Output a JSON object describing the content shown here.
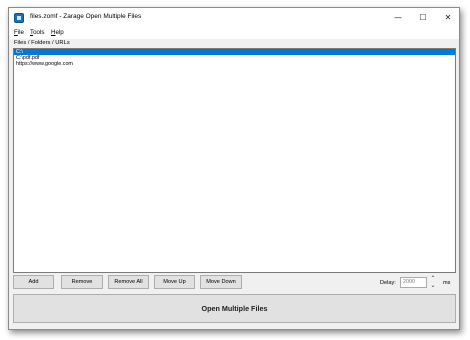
{
  "window": {
    "title": "files.zomf - Zarage Open Multiple Files",
    "controls": {
      "minimize": "—",
      "maximize": "☐",
      "close": "✕"
    }
  },
  "menu": {
    "file_mnemonic": "F",
    "file_rest": "ile",
    "tools_mnemonic": "T",
    "tools_rest": "ools",
    "help_mnemonic": "H",
    "help_rest": "elp"
  },
  "list": {
    "label": "Files / Folders / URLs",
    "items": [
      "C:\\",
      "C:\\pdf.pdf",
      "https://www.google.com"
    ],
    "selected_index": 0
  },
  "buttons": {
    "add": "Add",
    "remove": "Remove",
    "remove_all": "Remove All",
    "move_up": "Move Up",
    "move_down": "Move Down",
    "open": "Open Multiple Files"
  },
  "delay": {
    "label": "Delay:",
    "value": "2000",
    "unit": "ms",
    "up_glyph": "⌃",
    "down_glyph": "⌄"
  },
  "colors": {
    "selection": "#0078d7",
    "window_bg": "#f0f0f0",
    "button_bg": "#e1e1e1"
  }
}
